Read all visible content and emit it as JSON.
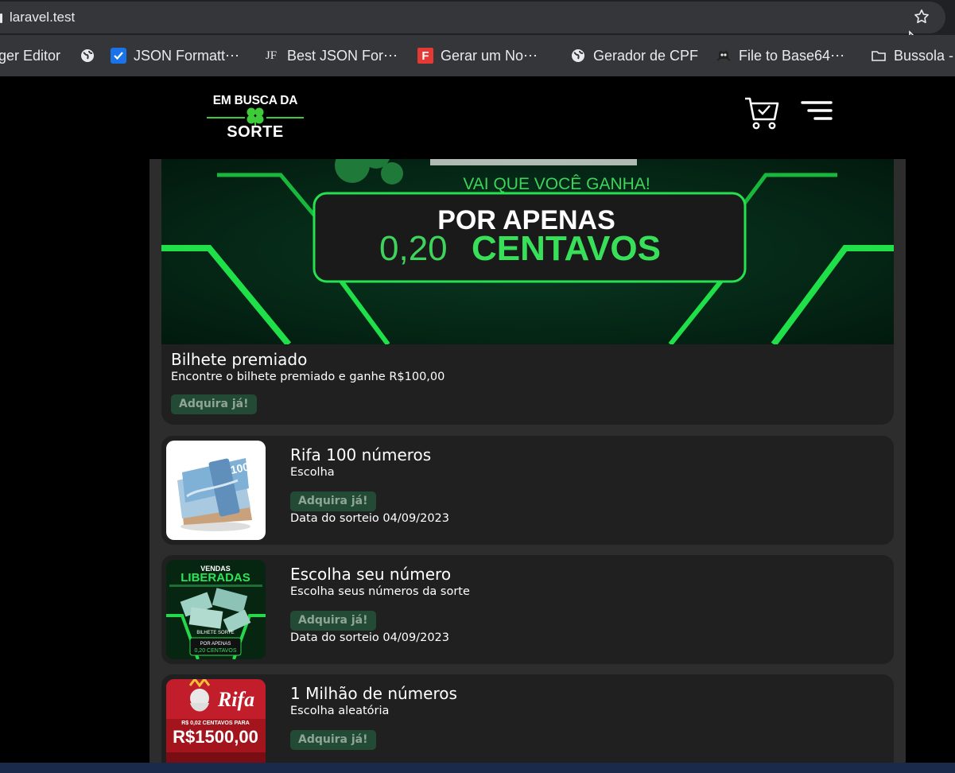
{
  "browser": {
    "url": "laravel.test",
    "bookmarks": [
      {
        "label": "ger Editor",
        "icon": "none"
      },
      {
        "label": "",
        "icon": "globe-icon"
      },
      {
        "label": "JSON Formatt⋯",
        "icon": "checkbox-icon"
      },
      {
        "label": "Best JSON For⋯",
        "icon": "jf-icon"
      },
      {
        "label": "Gerar um No⋯",
        "icon": "f-icon"
      },
      {
        "label": "Gerador de CPF",
        "icon": "globe-icon"
      },
      {
        "label": "File to Base64⋯",
        "icon": "robot-icon"
      },
      {
        "label": "Bussola -",
        "icon": "folder-icon"
      }
    ]
  },
  "header": {
    "logo_top": "EM BUSCA DA",
    "logo_bottom": "SORTE",
    "accent_color": "#3ecb39"
  },
  "featured": {
    "banner_tagline": "VAI QUE VOCÊ GANHA!",
    "banner_line1": "POR APENAS",
    "banner_price": "0,20",
    "banner_unit": "CENTAVOS",
    "title": "Bilhete premiado",
    "subtitle": "Encontre o bilhete premiado e ganhe R$100,00",
    "button": "Adquira já!"
  },
  "raffles": [
    {
      "title": "Rifa 100 números",
      "subtitle": "Escolha",
      "button": "Adquira já!",
      "date": "Data do sorteio 04/09/2023",
      "image": "money-bundle"
    },
    {
      "title": "Escolha seu número",
      "subtitle": "Escolha seus números da sorte",
      "button": "Adquira já!",
      "date": "Data do sorteio 04/09/2023",
      "image": "vendas-liberadas",
      "thumb_text": {
        "line1": "VENDAS",
        "line2": "LIBERADAS",
        "line3": "POR APENAS",
        "line4": "0,20 CENTAVOS"
      }
    },
    {
      "title": "1 Milhão de números",
      "subtitle": "Escolha aleatória",
      "button": "Adquira já!",
      "date": "",
      "image": "rei-da-rifa",
      "thumb_text": {
        "line1": "Rifa",
        "line2": "R$ 0,02 CENTAVOS PARA",
        "line3": "R$1500,00"
      }
    }
  ]
}
